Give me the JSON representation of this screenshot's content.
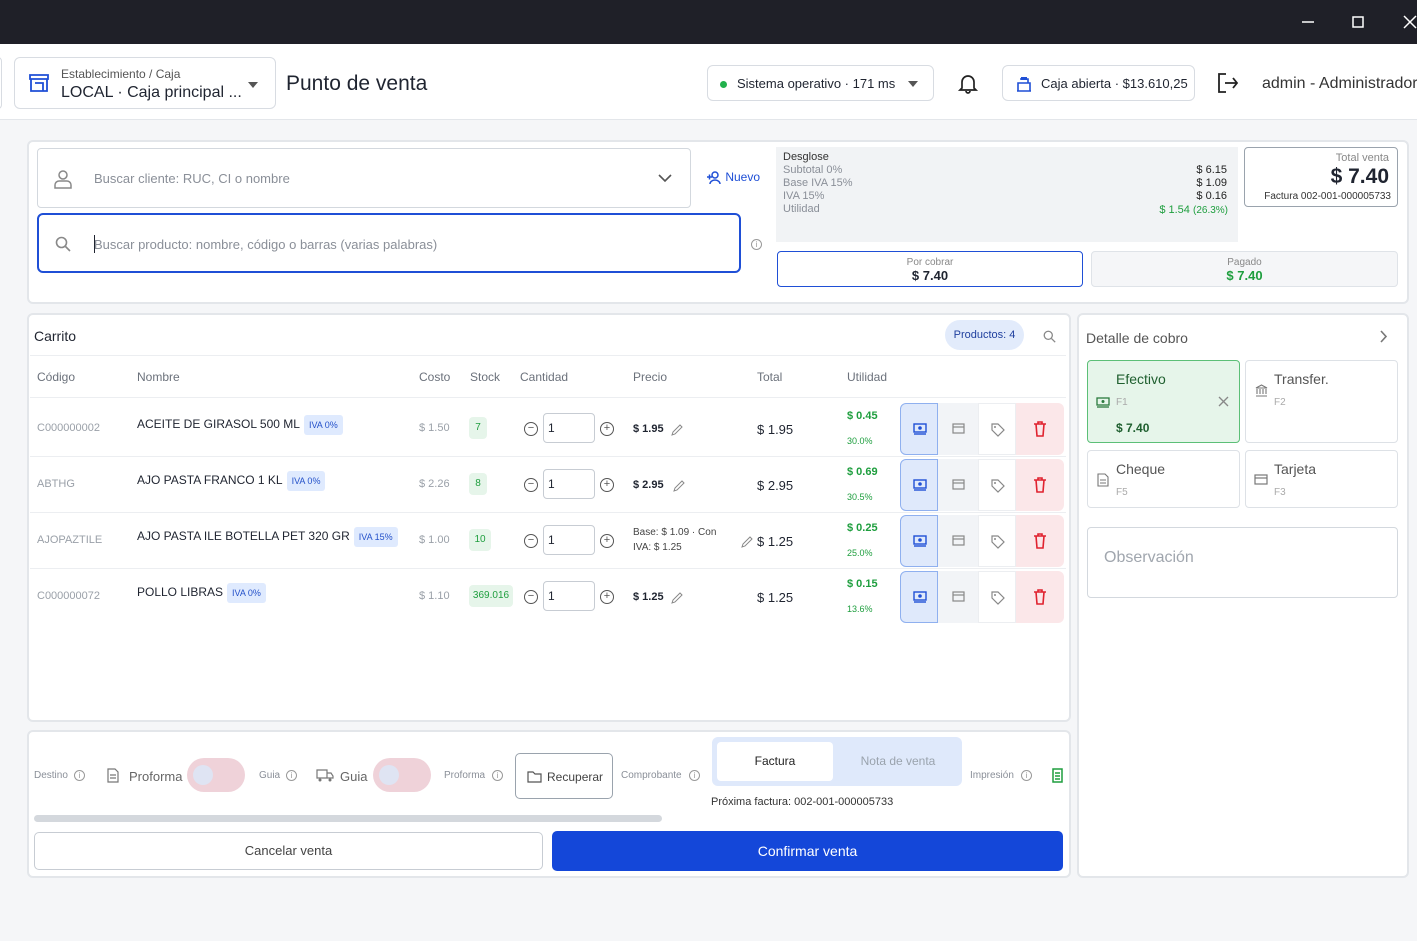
{
  "window": {
    "minimize_icon": "minimize-icon",
    "maximize_icon": "maximize-icon",
    "close_icon": "close-icon"
  },
  "header": {
    "establishment_label": "Establecimiento / Caja",
    "establishment_value": "LOCAL · Caja principal ...",
    "page_title": "Punto de venta",
    "status_text": "Sistema operativo · 171 ms",
    "status_color": "#22b14c",
    "caja_text": "Caja abierta · $13.610,25",
    "user_text": "admin - Administrador"
  },
  "search": {
    "client_placeholder": "Buscar cliente: RUC, CI o nombre",
    "new_client_label": "Nuevo",
    "product_placeholder": "Buscar producto: nombre, código o barras (varias palabras)"
  },
  "summary": {
    "desglose_title": "Desglose",
    "rows": [
      {
        "label": "Subtotal 0%",
        "value": "$ 6.15"
      },
      {
        "label": "Base IVA 15%",
        "value": "$ 1.09"
      },
      {
        "label": "IVA 15%",
        "value": "$ 0.16"
      },
      {
        "label": "Utilidad",
        "value": "$ 1.54",
        "extra": "(26.3%)"
      }
    ],
    "total_label": "Total venta",
    "total_value": "$ 7.40",
    "invoice_number": "Factura 002-001-000005733",
    "por_cobrar_label": "Por cobrar",
    "por_cobrar_value": "$ 7.40",
    "pagado_label": "Pagado",
    "pagado_value": "$ 7.40"
  },
  "cart": {
    "title": "Carrito",
    "products_badge": "Productos: 4",
    "columns": [
      "Código",
      "Nombre",
      "Costo",
      "Stock",
      "Cantidad",
      "Precio",
      "Total",
      "Utilidad"
    ],
    "rows": [
      {
        "code": "C000000002",
        "name": "ACEITE DE GIRASOL 500 ML",
        "iva": "IVA 0%",
        "cost": "$ 1.50",
        "stock": "7",
        "qty": "1",
        "price": "$ 1.95",
        "total": "$ 1.95",
        "profit": "$ 0.45",
        "profit_pct": "30.0%"
      },
      {
        "code": "ABTHG",
        "name": "AJO PASTA FRANCO 1 KL",
        "iva": "IVA 0%",
        "cost": "$ 2.26",
        "stock": "8",
        "qty": "1",
        "price": "$ 2.95",
        "total": "$ 2.95",
        "profit": "$ 0.69",
        "profit_pct": "30.5%"
      },
      {
        "code": "AJOPAZTILE",
        "name": "AJO PASTA ILE BOTELLA PET 320 GR",
        "iva": "IVA 15%",
        "cost": "$ 1.00",
        "stock": "10",
        "qty": "1",
        "price_line1": "Base: $ 1.09 · Con",
        "price_line2": "IVA: $ 1.25",
        "total": "$ 1.25",
        "profit": "$ 0.25",
        "profit_pct": "25.0%"
      },
      {
        "code": "C000000072",
        "name": "POLLO LIBRAS",
        "iva": "IVA 0%",
        "cost": "$ 1.10",
        "stock": "369.016",
        "qty": "1",
        "price": "$ 1.25",
        "total": "$ 1.25",
        "profit": "$ 0.15",
        "profit_pct": "13.6%"
      }
    ]
  },
  "bottom": {
    "destino_label": "Destino",
    "proforma_label": "Proforma",
    "guia_label": "Guia",
    "guia_button": "Guia",
    "proforma_label2": "Proforma",
    "recuperar_label": "Recuperar",
    "comprobante_label": "Comprobante",
    "factura_tab": "Factura",
    "nota_tab": "Nota de venta",
    "impresion_label": "Impresión",
    "next_invoice": "Próxima factura: 002-001-000005733",
    "cancel_label": "Cancelar venta",
    "confirm_label": "Confirmar venta",
    "confirm_color": "#1447d9"
  },
  "payment": {
    "title": "Detalle de cobro",
    "methods": [
      {
        "label": "Efectivo",
        "key": "F1",
        "amount": "$ 7.40"
      },
      {
        "label": "Transfer.",
        "key": "F2"
      },
      {
        "label": "Cheque",
        "key": "F5"
      },
      {
        "label": "Tarjeta",
        "key": "F3"
      }
    ],
    "observation_placeholder": "Observación"
  }
}
